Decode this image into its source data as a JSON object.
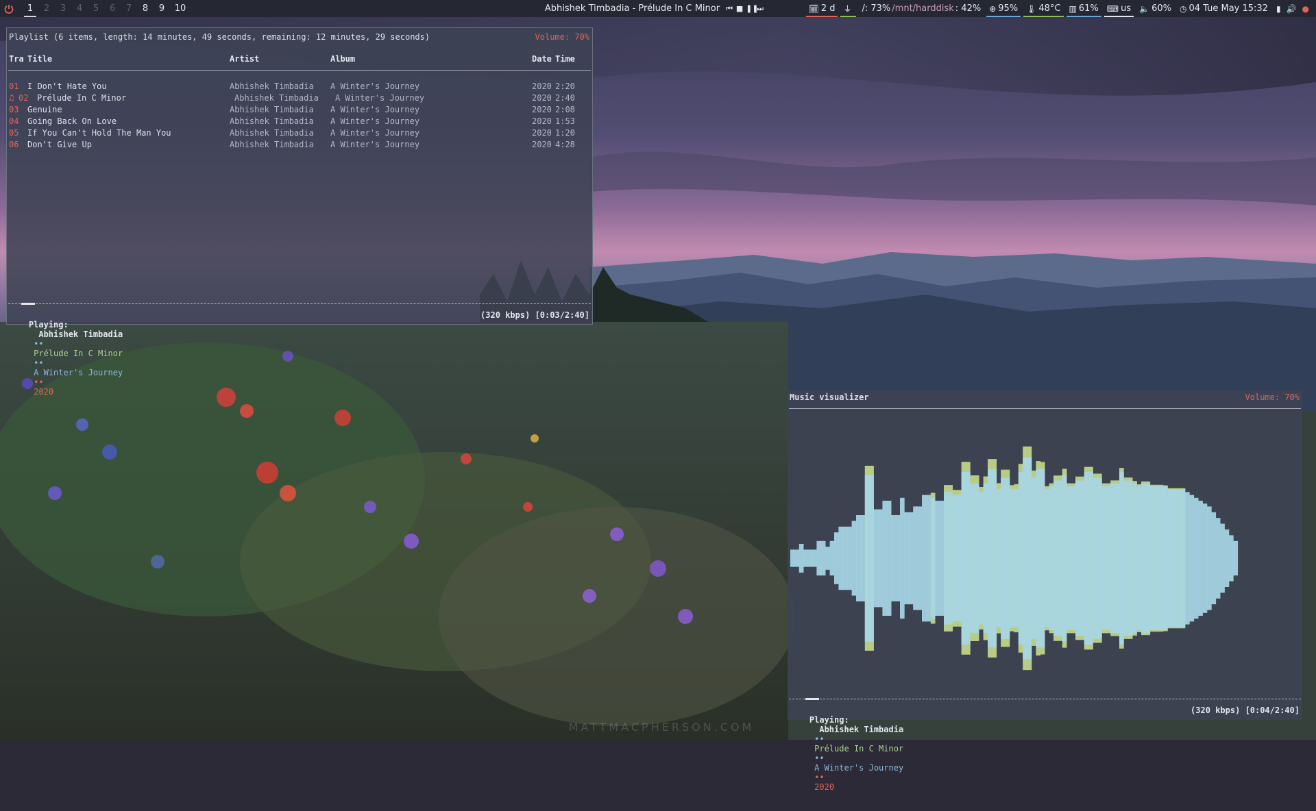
{
  "topbar": {
    "workspaces": [
      {
        "label": "1",
        "active": true
      },
      {
        "label": "2",
        "active": false
      },
      {
        "label": "3",
        "active": false
      },
      {
        "label": "4",
        "active": false
      },
      {
        "label": "5",
        "active": false
      },
      {
        "label": "6",
        "active": false
      },
      {
        "label": "7",
        "active": false
      },
      {
        "label": "8",
        "active": false
      },
      {
        "label": "9",
        "active": false
      },
      {
        "label": "10",
        "active": false
      }
    ],
    "now_playing": "Abhishek Timbadia - Prélude In C Minor",
    "media_controls": [
      "prev-icon",
      "stop-icon",
      "pause-icon",
      "next-icon"
    ],
    "updates": "2 d",
    "disk_root_label": "/: 73%",
    "disk_mnt_path": "/mnt/harddisk",
    "disk_mnt_value": ": 42%",
    "cpu": "95%",
    "temperature": "48°C",
    "memory": "61%",
    "keyboard": "us",
    "volume": "60%",
    "datetime": "04 Tue May 15:32",
    "accent_colors": {
      "red": "#e0645a",
      "green": "#8fbf5a",
      "blue": "#6ea6d8",
      "purple": "#c79bb7"
    }
  },
  "playlist": {
    "header": "Playlist (6 items, length: 14 minutes, 49 seconds, remaining: 12 minutes, 29 seconds)",
    "volume": "Volume: 70%",
    "columns": {
      "track": "Tra",
      "title": "Title",
      "artist": "Artist",
      "album": "Album",
      "date": "Date",
      "time": "Time"
    },
    "rows": [
      {
        "num": "01",
        "title": "I Don't Hate You",
        "artist": "Abhishek Timbadia",
        "album": "A Winter's Journey",
        "date": "2020",
        "time": "2:20",
        "playing": false
      },
      {
        "num": "02",
        "title": "Prélude In C Minor",
        "artist": "Abhishek Timbadia",
        "album": "A Winter's Journey",
        "date": "2020",
        "time": "2:40",
        "playing": true
      },
      {
        "num": "03",
        "title": "Genuine",
        "artist": "Abhishek Timbadia",
        "album": "A Winter's Journey",
        "date": "2020",
        "time": "2:08",
        "playing": false
      },
      {
        "num": "04",
        "title": "Going Back On Love",
        "artist": "Abhishek Timbadia",
        "album": "A Winter's Journey",
        "date": "2020",
        "time": "1:53",
        "playing": false
      },
      {
        "num": "05",
        "title": "If You Can't Hold The Man You",
        "artist": "Abhishek Timbadia",
        "album": "A Winter's Journey",
        "date": "2020",
        "time": "1:20",
        "playing": false
      },
      {
        "num": "06",
        "title": "Don't Give Up",
        "artist": "Abhishek Timbadia",
        "album": "A Winter's Journey",
        "date": "2020",
        "time": "4:28",
        "playing": false
      }
    ],
    "playing_marker": "♫",
    "status": {
      "label": "Playing:",
      "artist": "Abhishek Timbadia",
      "sep": "••",
      "title": "Prélude In C Minor",
      "album": "A Winter's Journey",
      "year": "2020",
      "right": "(320 kbps) [0:03/2:40]"
    },
    "progress": 0.02
  },
  "visualizer": {
    "header": "Music visualizer",
    "volume": "Volume: 70%",
    "status": {
      "label": "Playing:",
      "artist": "Abhishek Timbadia",
      "sep": "••",
      "title": "Prélude In C Minor",
      "album": "A Winter's Journey",
      "year": "2020",
      "right": "(320 kbps) [0:04/2:40]"
    },
    "progress": 0.03,
    "bar_color": "#a7d6e6",
    "peak_color": "#b8cc86",
    "amplitudes": [
      0.06,
      0.06,
      0.1,
      0.06,
      0.06,
      0.06,
      0.12,
      0.12,
      0.08,
      0.12,
      0.18,
      0.22,
      0.22,
      0.22,
      0.26,
      0.3,
      0.3,
      0.58,
      0.58,
      0.34,
      0.34,
      0.4,
      0.4,
      0.3,
      0.3,
      0.42,
      0.32,
      0.32,
      0.36,
      0.36,
      0.44,
      0.44,
      0.42,
      0.4,
      0.4,
      0.46,
      0.46,
      0.44,
      0.44,
      0.6,
      0.6,
      0.52,
      0.52,
      0.46,
      0.52,
      0.62,
      0.62,
      0.48,
      0.56,
      0.56,
      0.48,
      0.48,
      0.6,
      0.7,
      0.7,
      0.56,
      0.62,
      0.62,
      0.48,
      0.5,
      0.54,
      0.54,
      0.58,
      0.5,
      0.5,
      0.54,
      0.54,
      0.6,
      0.6,
      0.56,
      0.56,
      0.5,
      0.5,
      0.52,
      0.52,
      0.6,
      0.54,
      0.54,
      0.52,
      0.5,
      0.52,
      0.52,
      0.5,
      0.5,
      0.5,
      0.5,
      0.48,
      0.48,
      0.48,
      0.48,
      0.46,
      0.44,
      0.42,
      0.4,
      0.38,
      0.36,
      0.32,
      0.28,
      0.24,
      0.2,
      0.16,
      0.12
    ],
    "peaks": [
      0,
      0,
      0,
      0,
      0,
      0,
      0,
      0,
      0,
      0,
      0,
      0,
      0,
      0,
      0,
      0,
      0,
      0.18,
      0.18,
      0,
      0,
      0,
      0,
      0,
      0,
      0,
      0,
      0,
      0,
      0,
      0,
      0,
      0.1,
      0,
      0,
      0.14,
      0.14,
      0.1,
      0.1,
      0.2,
      0.2,
      0.16,
      0.16,
      0.1,
      0.14,
      0.2,
      0.2,
      0.12,
      0.16,
      0.16,
      0.08,
      0.1,
      0.16,
      0.22,
      0.22,
      0.14,
      0.16,
      0.14,
      0.06,
      0.06,
      0.1,
      0.1,
      0.12,
      0.06,
      0.06,
      0.08,
      0.08,
      0.1,
      0.1,
      0.08,
      0.08,
      0.06,
      0.06,
      0.06,
      0.06,
      0.08,
      0.06,
      0.06,
      0.05,
      0.04,
      0.04,
      0.04,
      0.03,
      0.03,
      0.03,
      0.02,
      0.02,
      0.02,
      0.02,
      0.02,
      0,
      0,
      0,
      0,
      0,
      0,
      0,
      0,
      0,
      0,
      0,
      0
    ]
  }
}
